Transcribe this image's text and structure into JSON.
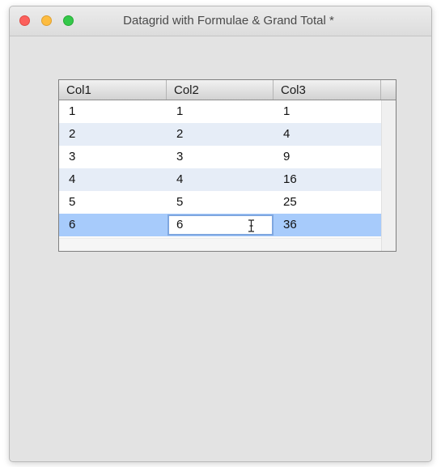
{
  "window": {
    "title": "Datagrid with Formulae & Grand Total *"
  },
  "colors": {
    "row_odd": "#ffffff",
    "row_even": "#e6edf7",
    "row_selected": "#a7cbfb"
  },
  "grid": {
    "columns": [
      {
        "label": "Col1"
      },
      {
        "label": "Col2"
      },
      {
        "label": "Col3"
      }
    ],
    "rows": [
      {
        "cells": [
          "1",
          "1",
          "1"
        ],
        "selected": false
      },
      {
        "cells": [
          "2",
          "2",
          "4"
        ],
        "selected": false
      },
      {
        "cells": [
          "3",
          "3",
          "9"
        ],
        "selected": false
      },
      {
        "cells": [
          "4",
          "4",
          "16"
        ],
        "selected": false
      },
      {
        "cells": [
          "5",
          "5",
          "25"
        ],
        "selected": false
      },
      {
        "cells": [
          "6",
          "6",
          "36"
        ],
        "selected": true
      }
    ],
    "editing": {
      "row": 5,
      "col": 1
    }
  }
}
